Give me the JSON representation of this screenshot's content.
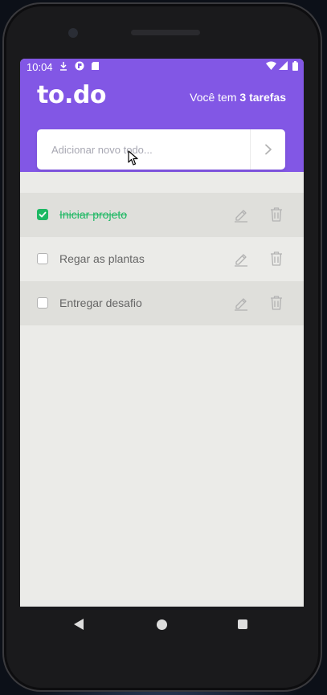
{
  "status_bar": {
    "time": "10:04",
    "icons": [
      "download-icon",
      "app-icon",
      "sd-card-icon",
      "wifi-icon",
      "signal-icon",
      "battery-icon"
    ]
  },
  "header": {
    "brand": "to.do",
    "counter_prefix": "Você tem",
    "counter_value": "3 tarefas",
    "background_color": "#8257e5"
  },
  "new_task": {
    "placeholder": "Adicionar novo todo...",
    "value": "",
    "submit_icon": "chevron-right-icon"
  },
  "tasks": [
    {
      "label": "Iniciar projeto",
      "done": true
    },
    {
      "label": "Regar as plantas",
      "done": false
    },
    {
      "label": "Entregar desafio",
      "done": false
    }
  ],
  "colors": {
    "accent": "#8257e5",
    "done": "#1db863",
    "text": "#666666"
  },
  "navigation": {
    "buttons": [
      "back-icon",
      "home-icon",
      "recents-icon"
    ]
  }
}
